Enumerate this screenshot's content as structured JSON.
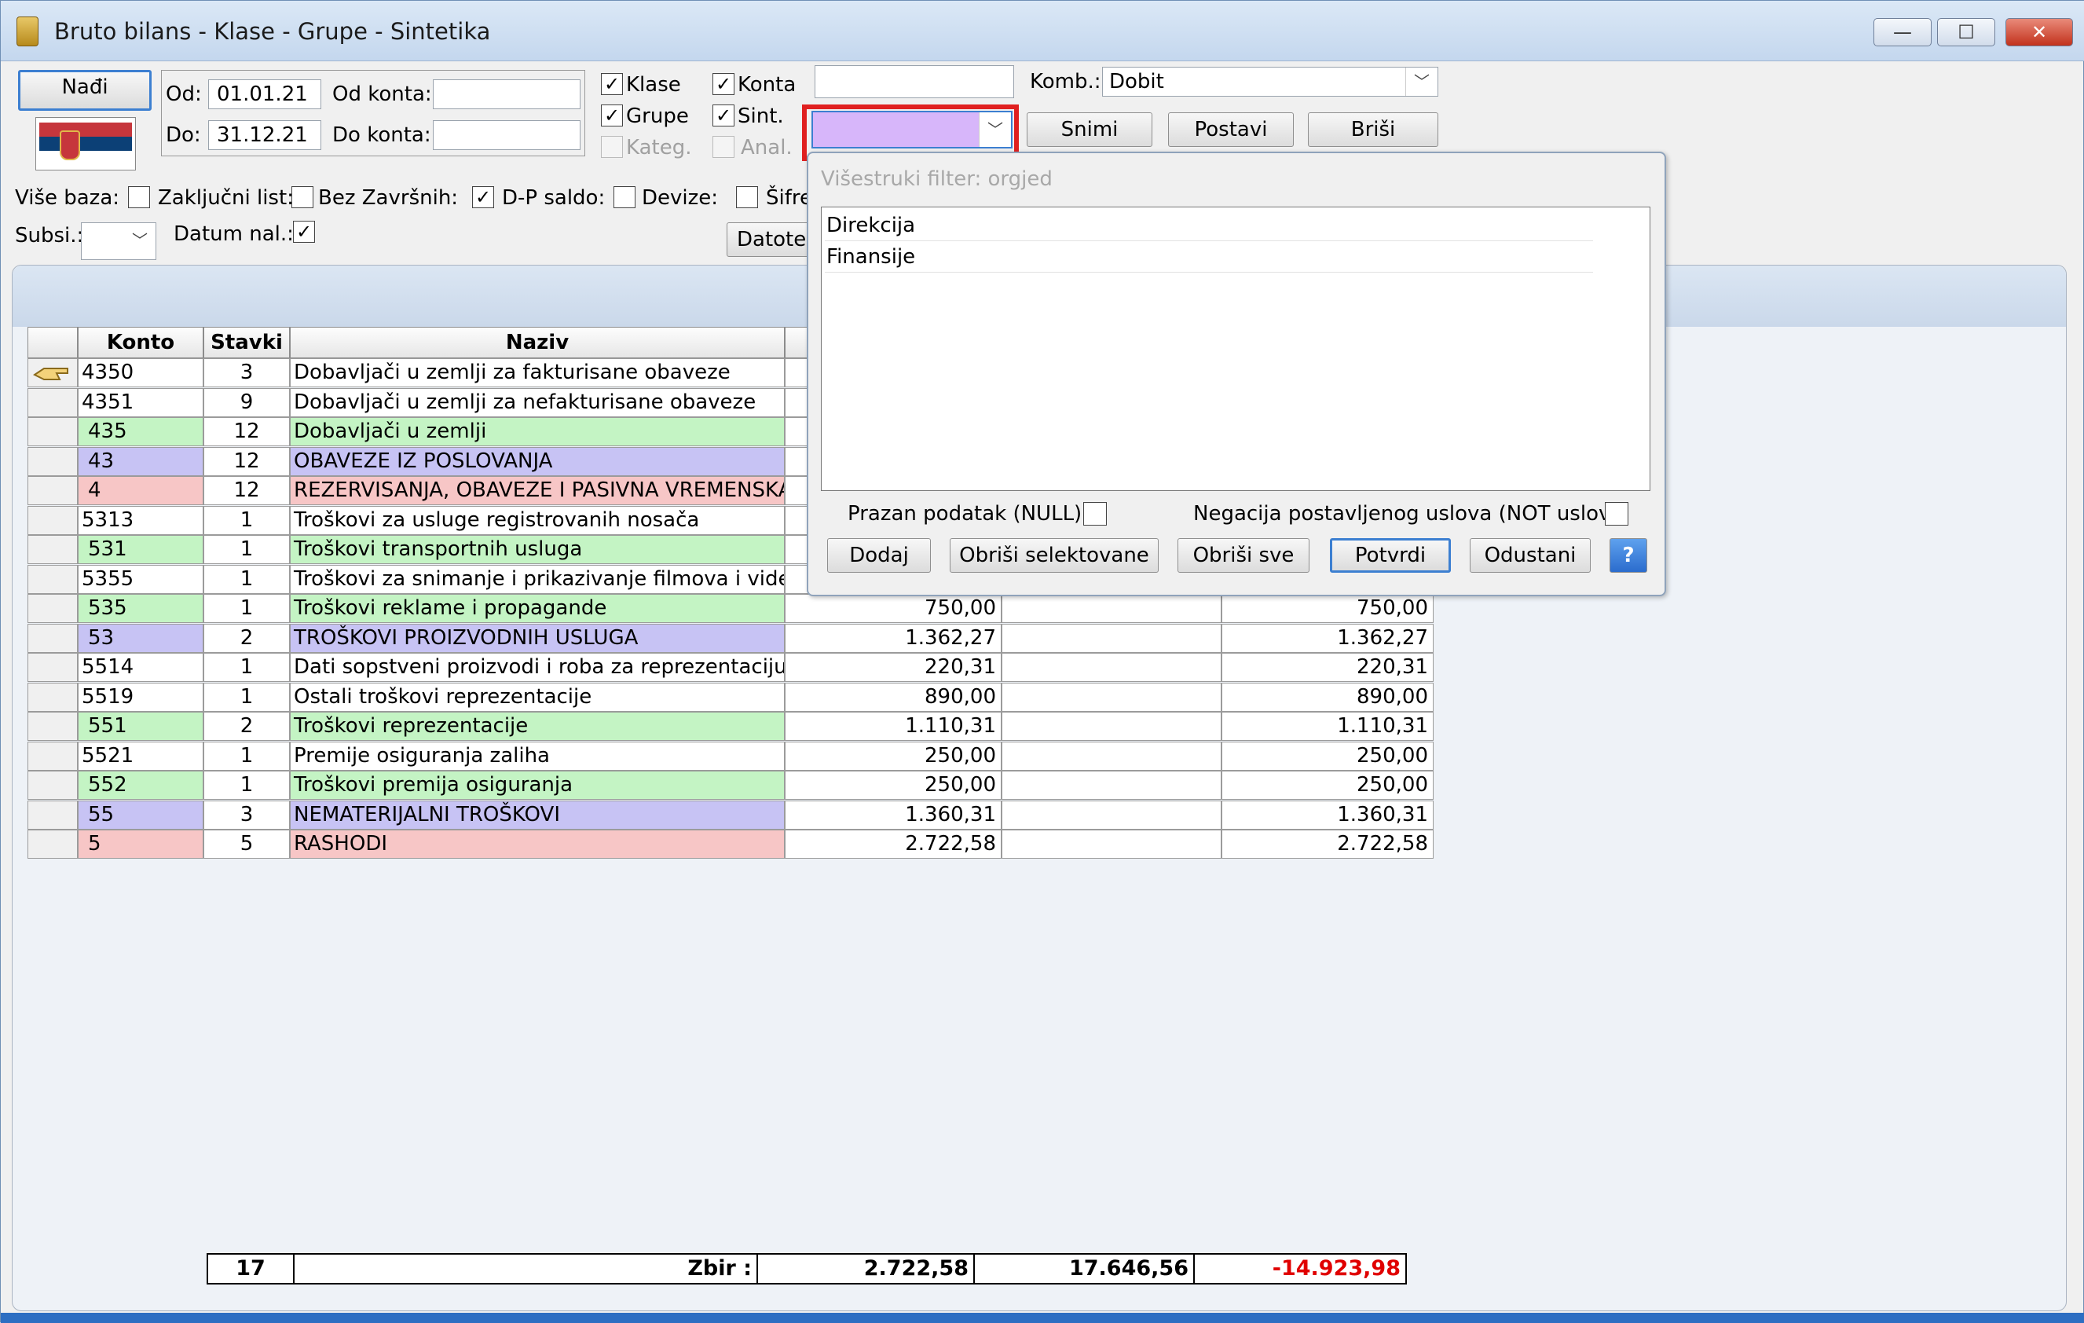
{
  "window": {
    "title": "Bruto bilans - Klase - Grupe - Sintetika",
    "controls": {
      "minimize": "—",
      "maximize": "☐",
      "close": "✕"
    }
  },
  "toolbar": {
    "find_button": "Nađi",
    "od_label": "Od:",
    "od_value": "01.01.21",
    "do_label": "Do:",
    "do_value": "31.12.21",
    "od_konta_label": "Od konta:",
    "do_konta_label": "Do konta:",
    "checks": {
      "klase": "Klase",
      "konta": "Konta",
      "grupe": "Grupe",
      "sint": "Sint.",
      "kateg": "Kateg.",
      "anal": "Anal."
    },
    "komb_label": "Komb.:",
    "komb_value": "Dobit",
    "snimi": "Snimi",
    "postavi": "Postavi",
    "brisi": "Briši",
    "vise_baza": "Više baza:",
    "zakljucni_list": "Zaključni list:",
    "bez_zavrsnih": "Bez Završnih:",
    "dp_saldo": "D-P saldo:",
    "devize": "Devize:",
    "sifre": "Šifre",
    "subsi": "Subsi.:",
    "datum_nal": "Datum nal.:",
    "datoteka": "Datoteka"
  },
  "grid": {
    "headers": {
      "konto": "Konto",
      "stavki": "Stavki",
      "naziv": "Naziv"
    },
    "rows": [
      {
        "konto": "4350",
        "stavki": "3",
        "naziv": "Dobavljači u zemlji za fakturisane obaveze",
        "color": "#ffffff",
        "d": "",
        "p": "",
        "s": ""
      },
      {
        "konto": "4351",
        "stavki": "9",
        "naziv": "Dobavljači u zemlji za nefakturisane obaveze",
        "color": "#ffffff",
        "d": "",
        "p": "",
        "s": ""
      },
      {
        "konto": "435",
        "stavki": "12",
        "naziv": "Dobavljači u zemlji",
        "color": "#c4f4c4",
        "d": "",
        "p": "",
        "s": ""
      },
      {
        "konto": "43",
        "stavki": "12",
        "naziv": "OBAVEZE IZ POSLOVANJA",
        "color": "#c7c3f4",
        "d": "",
        "p": "",
        "s": ""
      },
      {
        "konto": "4",
        "stavki": "12",
        "naziv": "REZERVISANJA, OBAVEZE I PASIVNA VREMENSKA",
        "color": "#f7c6c6",
        "d": "",
        "p": "",
        "s": ""
      },
      {
        "konto": "5313",
        "stavki": "1",
        "naziv": "Troškovi za usluge registrovanih nosača",
        "color": "#ffffff",
        "d": "",
        "p": "",
        "s": ""
      },
      {
        "konto": "531",
        "stavki": "1",
        "naziv": "Troškovi transportnih usluga",
        "color": "#c4f4c4",
        "d": "",
        "p": "",
        "s": ""
      },
      {
        "konto": "5355",
        "stavki": "1",
        "naziv": "Troškovi za snimanje i prikazivanje filmova i video",
        "color": "#ffffff",
        "d": "",
        "p": "",
        "s": ""
      },
      {
        "konto": "535",
        "stavki": "1",
        "naziv": "Troškovi reklame i propagande",
        "color": "#c4f4c4",
        "d": "750,00",
        "p": "",
        "s": "750,00"
      },
      {
        "konto": "53",
        "stavki": "2",
        "naziv": "TROŠKOVI PROIZVODNIH USLUGA",
        "color": "#c7c3f4",
        "d": "1.362,27",
        "p": "",
        "s": "1.362,27"
      },
      {
        "konto": "5514",
        "stavki": "1",
        "naziv": "Dati sopstveni proizvodi i roba za reprezentaciju",
        "color": "#ffffff",
        "d": "220,31",
        "p": "",
        "s": "220,31"
      },
      {
        "konto": "5519",
        "stavki": "1",
        "naziv": "Ostali troškovi reprezentacije",
        "color": "#ffffff",
        "d": "890,00",
        "p": "",
        "s": "890,00"
      },
      {
        "konto": "551",
        "stavki": "2",
        "naziv": "Troškovi reprezentacije",
        "color": "#c4f4c4",
        "d": "1.110,31",
        "p": "",
        "s": "1.110,31"
      },
      {
        "konto": "5521",
        "stavki": "1",
        "naziv": "Premije osiguranja zaliha",
        "color": "#ffffff",
        "d": "250,00",
        "p": "",
        "s": "250,00"
      },
      {
        "konto": "552",
        "stavki": "1",
        "naziv": "Troškovi premija osiguranja",
        "color": "#c4f4c4",
        "d": "250,00",
        "p": "",
        "s": "250,00"
      },
      {
        "konto": "55",
        "stavki": "3",
        "naziv": "NEMATERIJALNI TROŠKOVI",
        "color": "#c7c3f4",
        "d": "1.360,31",
        "p": "",
        "s": "1.360,31"
      },
      {
        "konto": "5",
        "stavki": "5",
        "naziv": "RASHODI",
        "color": "#f7c6c6",
        "d": "2.722,58",
        "p": "",
        "s": "2.722,58"
      }
    ],
    "totals": {
      "count": "17",
      "label": "Zbir :",
      "duguje": "2.722,58",
      "potrazuje": "17.646,56",
      "saldo": "-14.923,98",
      "saldo_color": "#e00000"
    }
  },
  "popup": {
    "title": "Višestruki filter: orgjed",
    "items": [
      "Direkcija",
      "Finansije"
    ],
    "null_label": "Prazan podatak (NULL):",
    "not_label": "Negacija postavljenog uslova (NOT uslov):",
    "buttons": {
      "dodaj": "Dodaj",
      "obrisi_sel": "Obriši selektovane",
      "obrisi_sve": "Obriši sve",
      "potvrdi": "Potvrdi",
      "odustani": "Odustani",
      "help": "?"
    }
  },
  "icons": [
    "app-icon",
    "serbia-flag-icon",
    "pointer-hand-icon",
    "chevron-down-icon",
    "help-icon"
  ],
  "colors": {
    "accent": "#3c7fd1",
    "highlight": "#e02020",
    "filter_combo": "#d7b6fa",
    "negative": "#e00000"
  }
}
